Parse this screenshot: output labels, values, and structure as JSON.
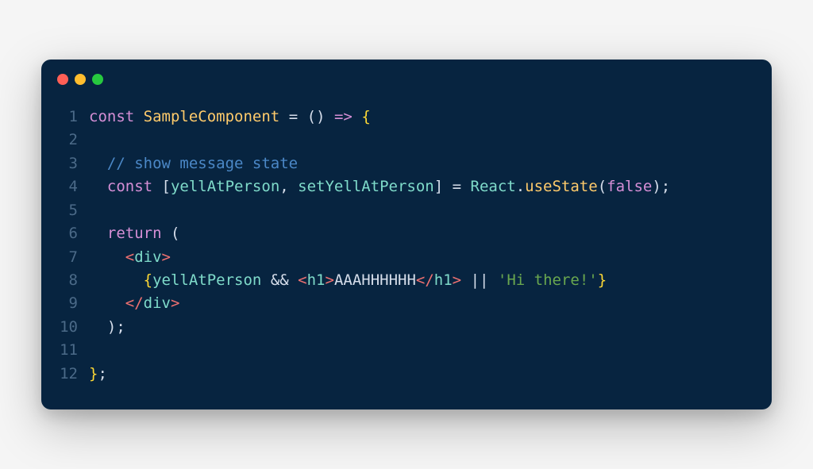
{
  "window": {
    "controls": [
      "close",
      "minimize",
      "maximize"
    ]
  },
  "code": {
    "lines": [
      {
        "n": "1",
        "tokens": [
          {
            "cls": "keyword",
            "t": "const"
          },
          {
            "cls": "punct",
            "t": " "
          },
          {
            "cls": "funcname",
            "t": "SampleComponent"
          },
          {
            "cls": "punct",
            "t": " "
          },
          {
            "cls": "punct",
            "t": "="
          },
          {
            "cls": "punct",
            "t": " "
          },
          {
            "cls": "punct",
            "t": "("
          },
          {
            "cls": "punct",
            "t": ")"
          },
          {
            "cls": "punct",
            "t": " "
          },
          {
            "cls": "keyword",
            "t": "=>"
          },
          {
            "cls": "punct",
            "t": " "
          },
          {
            "cls": "brace",
            "t": "{"
          }
        ]
      },
      {
        "n": "2",
        "tokens": []
      },
      {
        "n": "3",
        "tokens": [
          {
            "cls": "punct",
            "t": "  "
          },
          {
            "cls": "comment",
            "t": "// show message state"
          }
        ]
      },
      {
        "n": "4",
        "tokens": [
          {
            "cls": "punct",
            "t": "  "
          },
          {
            "cls": "keyword",
            "t": "const"
          },
          {
            "cls": "punct",
            "t": " ["
          },
          {
            "cls": "varname",
            "t": "yellAtPerson"
          },
          {
            "cls": "punct",
            "t": ", "
          },
          {
            "cls": "varname",
            "t": "setYellAtPerson"
          },
          {
            "cls": "punct",
            "t": "] = "
          },
          {
            "cls": "react",
            "t": "React"
          },
          {
            "cls": "punct",
            "t": "."
          },
          {
            "cls": "method",
            "t": "useState"
          },
          {
            "cls": "punct",
            "t": "("
          },
          {
            "cls": "boolean",
            "t": "false"
          },
          {
            "cls": "punct",
            "t": ");"
          }
        ]
      },
      {
        "n": "5",
        "tokens": []
      },
      {
        "n": "6",
        "tokens": [
          {
            "cls": "punct",
            "t": "  "
          },
          {
            "cls": "keyword",
            "t": "return"
          },
          {
            "cls": "punct",
            "t": " ("
          }
        ]
      },
      {
        "n": "7",
        "tokens": [
          {
            "cls": "punct",
            "t": "    "
          },
          {
            "cls": "tag",
            "t": "<"
          },
          {
            "cls": "tagname",
            "t": "div"
          },
          {
            "cls": "tag",
            "t": ">"
          }
        ]
      },
      {
        "n": "8",
        "tokens": [
          {
            "cls": "punct",
            "t": "      "
          },
          {
            "cls": "brace",
            "t": "{"
          },
          {
            "cls": "varname",
            "t": "yellAtPerson"
          },
          {
            "cls": "punct",
            "t": " && "
          },
          {
            "cls": "tag",
            "t": "<"
          },
          {
            "cls": "tagname",
            "t": "h1"
          },
          {
            "cls": "tag",
            "t": ">"
          },
          {
            "cls": "text",
            "t": "AAAHHHHHH"
          },
          {
            "cls": "tag",
            "t": "</"
          },
          {
            "cls": "tagname",
            "t": "h1"
          },
          {
            "cls": "tag",
            "t": ">"
          },
          {
            "cls": "punct",
            "t": " || "
          },
          {
            "cls": "string",
            "t": "'Hi there!'"
          },
          {
            "cls": "brace",
            "t": "}"
          }
        ]
      },
      {
        "n": "9",
        "tokens": [
          {
            "cls": "punct",
            "t": "    "
          },
          {
            "cls": "tag",
            "t": "</"
          },
          {
            "cls": "tagname",
            "t": "div"
          },
          {
            "cls": "tag",
            "t": ">"
          }
        ]
      },
      {
        "n": "10",
        "tokens": [
          {
            "cls": "punct",
            "t": "  );"
          }
        ]
      },
      {
        "n": "11",
        "tokens": []
      },
      {
        "n": "12",
        "tokens": [
          {
            "cls": "brace",
            "t": "}"
          },
          {
            "cls": "punct",
            "t": ";"
          }
        ]
      }
    ]
  }
}
